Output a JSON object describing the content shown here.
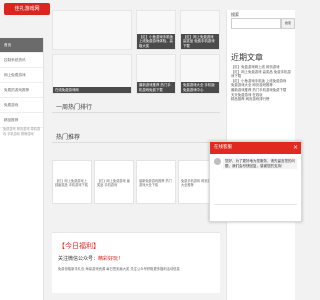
{
  "brand": {
    "name": "佳礼游戏网"
  },
  "sidebar": {
    "items": [
      {
        "label": "首页"
      },
      {
        "label": "控制系统资讯"
      },
      {
        "label": "网上免费游戏"
      },
      {
        "label": "免费的游戏推荐"
      },
      {
        "label": "免费游戏"
      },
      {
        "label": "精品推荐"
      }
    ],
    "tags": "免费游戏 网页游戏 单机游戏 手机游戏 棋牌游戏"
  },
  "tiles": [
    {
      "caption": ""
    },
    {
      "caption": "【红】小鱼游戏手机版上线免费游戏体验，赢取大奖"
    },
    {
      "caption": "【红】网上免费游戏 赢奖品 免费手机游戏下载"
    },
    {
      "caption": "在线免费游戏网"
    },
    {
      "caption": "最新游戏推荐 热门手机游戏免费下载"
    },
    {
      "caption": "免费游戏大全 手机版免费游戏中心"
    }
  ],
  "sections": {
    "hot": "一周热门排行",
    "recommend": "热门推荐"
  },
  "hot_items": [
    {
      "text": "【红】网上免费游戏上线赢奖品 手机游戏下载"
    },
    {
      "text": "【红】网上免费游戏 赢奖品 手机游戏"
    },
    {
      "text": "最新免费游戏推荐 热门游戏大全下载"
    },
    {
      "text": "免费手机游戏 网页游戏大全推荐"
    }
  ],
  "today": {
    "title": "【今日福利】",
    "line1_prefix": "关注微信公众号：",
    "line1_highlight": "精彩好玩！",
    "line2": "免费领取新手礼包 海量游戏资源 每日签到赢大奖 关注公众号获取更多福利活动信息"
  },
  "right": {
    "search_label": "搜索",
    "search_placeholder": "",
    "search_button": "搜索",
    "recent_title": "近期文章",
    "recent_items": [
      "【红】免费游戏网上线 网页游戏",
      "【红】网上免费游戏 赢奖品 免费手机游戏下载",
      "【红】小鱼游戏手机版 上线免费游戏",
      "免费游戏大全 网页游戏推荐",
      "最新游戏推荐 热门手机游戏免费下载",
      "天天免费游戏 在线玩",
      "精品推荐 网页游戏排行榜"
    ]
  },
  "popup": {
    "title": "在线客服",
    "message": "您好，为了更好地为您服务，请先留言您的问题，我们会尽快回复，感谢您的支持！"
  },
  "colors": {
    "accent": "#e02a1f",
    "dark": "#4b4b4b"
  },
  "icons": {
    "close": "close-icon",
    "avatar": "avatar-icon"
  }
}
